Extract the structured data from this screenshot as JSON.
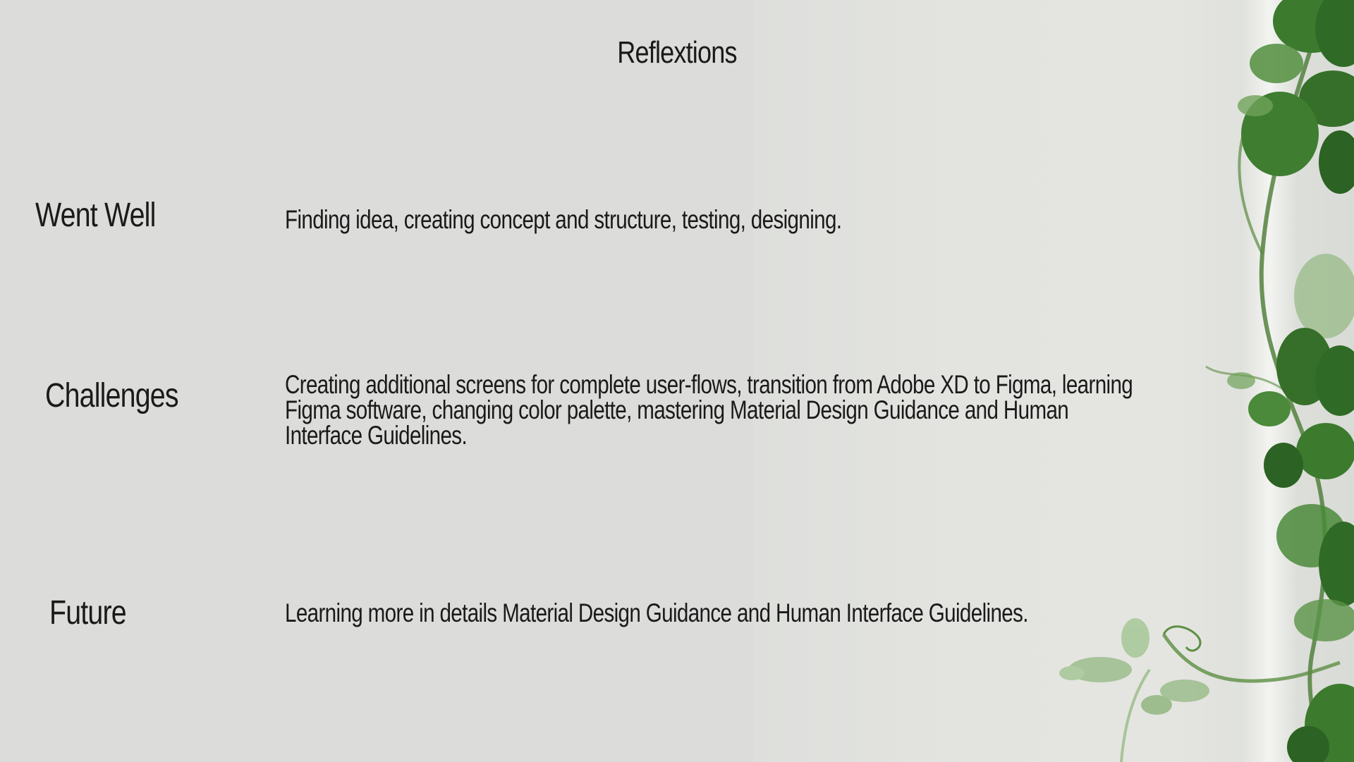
{
  "slide": {
    "title": "Reflextions",
    "sections": [
      {
        "label": "Went Well",
        "text": "Finding idea, creating concept and structure, testing, designing."
      },
      {
        "label": "Challenges",
        "text": "Creating additional screens for complete user-flows, transition from Adobe XD to Figma, learning Figma software, changing color palette, mastering Material Design Guidance and Human Interface Guidelines."
      },
      {
        "label": "Future",
        "text": "Learning more in details Material Design Guidance and Human Interface Guidelines."
      }
    ]
  },
  "colors": {
    "background": "#dcdcdb",
    "wall": "#e3e4e0",
    "text": "#1a1a1a",
    "leaf_dark": "#2f6b26",
    "leaf_mid": "#4a8a3a",
    "leaf_light": "#7fae6a"
  },
  "icons": {
    "decoration": "plant-leaves-image"
  }
}
